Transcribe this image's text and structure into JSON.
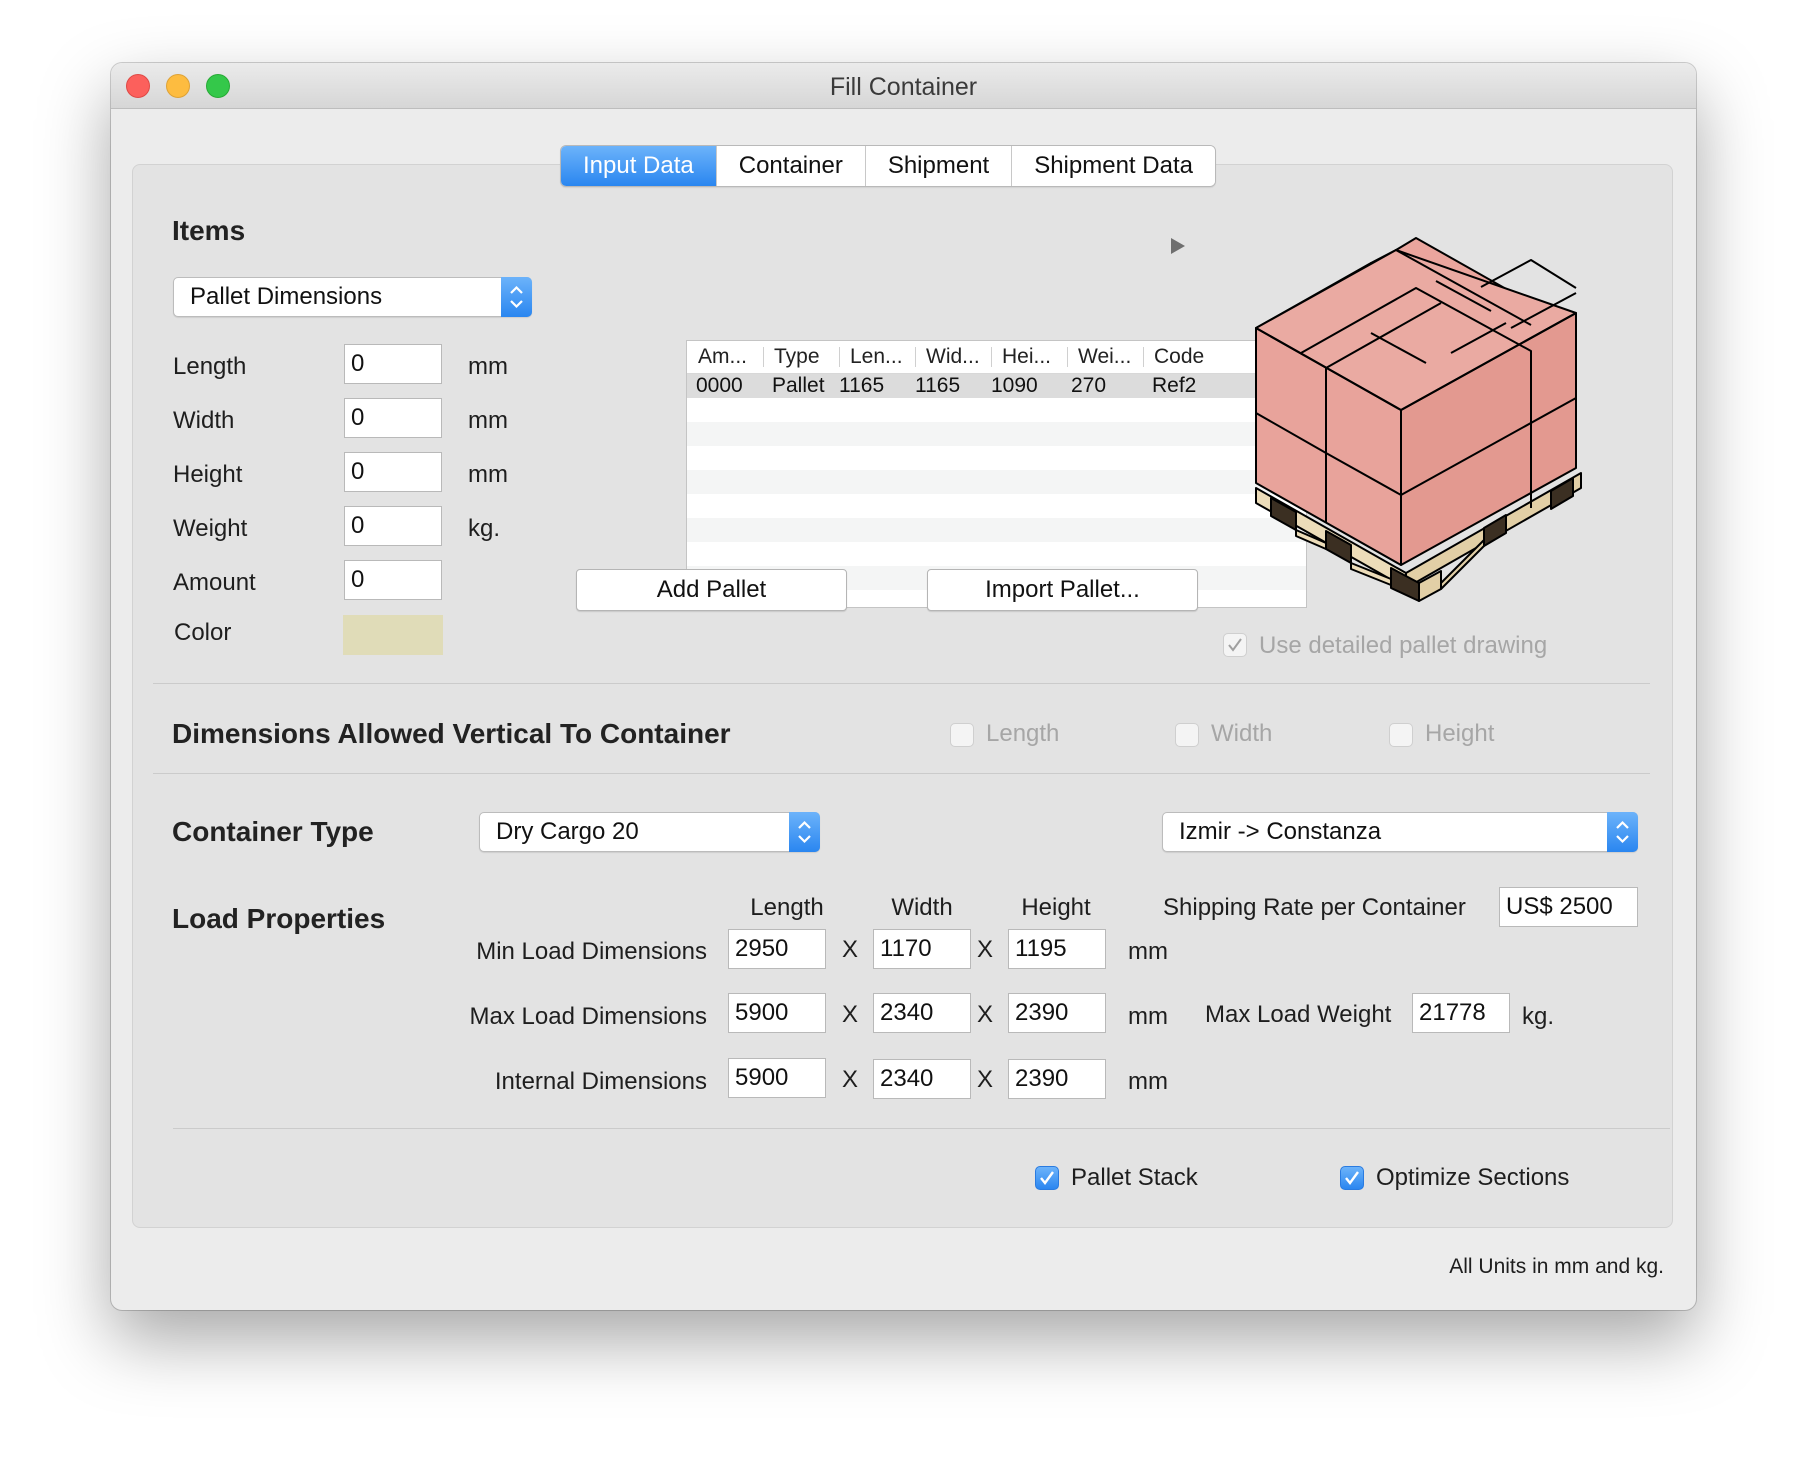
{
  "window": {
    "title": "Fill Container"
  },
  "tabs": [
    {
      "label": "Input Data",
      "active": true
    },
    {
      "label": "Container",
      "active": false
    },
    {
      "label": "Shipment",
      "active": false
    },
    {
      "label": "Shipment Data",
      "active": false
    }
  ],
  "items": {
    "heading": "Items",
    "type_popup": "Pallet Dimensions",
    "fields": [
      {
        "label": "Length",
        "value": "0",
        "unit": "mm"
      },
      {
        "label": "Width",
        "value": "0",
        "unit": "mm"
      },
      {
        "label": "Height",
        "value": "0",
        "unit": "mm"
      },
      {
        "label": "Weight",
        "value": "0",
        "unit": "kg."
      },
      {
        "label": "Amount",
        "value": "0",
        "unit": ""
      }
    ],
    "color_label": "Color",
    "color_value": "#e0dcb8",
    "table": {
      "columns": [
        "Am...",
        "Type",
        "Len...",
        "Wid...",
        "Hei...",
        "Wei...",
        "Code"
      ],
      "rows": [
        [
          "0000",
          "Pallet",
          "1165",
          "1165",
          "1090",
          "270",
          "Ref2"
        ]
      ]
    },
    "add_button": "Add Pallet",
    "import_button": "Import Pallet...",
    "detailed_drawing_label": "Use detailed pallet drawing",
    "detailed_drawing_checked": true
  },
  "vertical": {
    "heading": "Dimensions Allowed Vertical To Container",
    "options": [
      {
        "label": "Length",
        "checked": false
      },
      {
        "label": "Width",
        "checked": false
      },
      {
        "label": "Height",
        "checked": false
      }
    ]
  },
  "container": {
    "heading": "Container Type",
    "type": "Dry Cargo 20",
    "route": "Izmir -> Constanza"
  },
  "load": {
    "heading": "Load Properties",
    "col_headers": [
      "Length",
      "Width",
      "Height"
    ],
    "separator": "X",
    "unit": "mm",
    "rows": [
      {
        "label": "Min Load Dimensions",
        "values": [
          "2950",
          "1170",
          "1195"
        ]
      },
      {
        "label": "Max Load Dimensions",
        "values": [
          "5900",
          "2340",
          "2390"
        ]
      },
      {
        "label": "Internal Dimensions",
        "values": [
          "5900",
          "2340",
          "2390"
        ]
      }
    ],
    "shipping_rate_label": "Shipping Rate per Container",
    "shipping_rate_value": "US$ 2500",
    "max_weight_label": "Max Load Weight",
    "max_weight_value": "21778",
    "max_weight_unit": "kg."
  },
  "options": [
    {
      "label": "Pallet Stack",
      "checked": true
    },
    {
      "label": "Optimize Sections",
      "checked": true
    }
  ],
  "footer": "All Units in mm and kg.",
  "colors": {
    "accent": "#2a86f0",
    "box": "#e8a39b",
    "pallet": "#ecdcb9"
  }
}
